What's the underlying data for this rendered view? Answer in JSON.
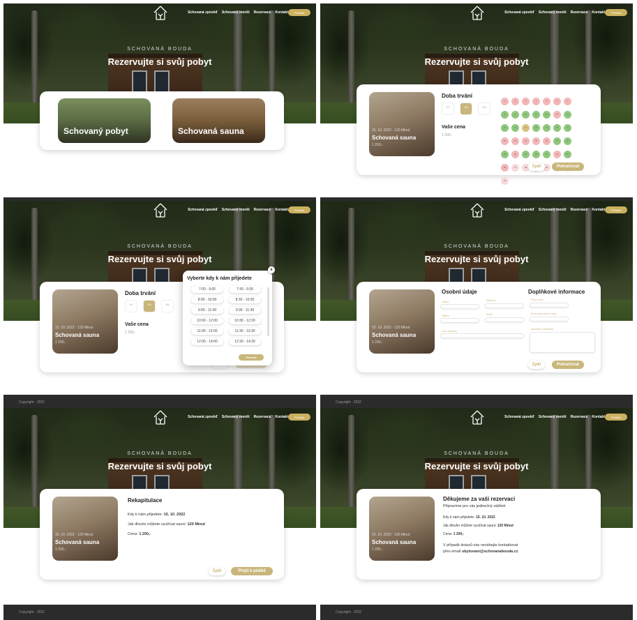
{
  "header": {
    "nav": [
      "Schovaná zpověď",
      "Schovaný menšt",
      "Rezervace",
      "Kontakt"
    ],
    "cta_label": "Přihlásit",
    "eyebrow": "SCHOVANÁ BOUDA",
    "title": "Rezervujte si svůj pobyt"
  },
  "footer": {
    "copyright": "Copyright · 2022"
  },
  "step1": {
    "options": [
      "Schovaný pobyt",
      "Schovaná sauna"
    ]
  },
  "product": {
    "date": "15. 10. 2022 · 120 Minut",
    "name": "Schovaná sauna",
    "price": "1 200,-"
  },
  "step2": {
    "duration_title": "Doba trvání",
    "durations": [
      "60",
      "120",
      "180"
    ],
    "price_title": "Vaše cena",
    "price": "1 200,-",
    "calendar": [
      "rd",
      "rd",
      "rd",
      "rd",
      "rd",
      "rd",
      "rd",
      "gr",
      "gr",
      "gr",
      "gr",
      "gr",
      "rd",
      "gr",
      "gr",
      "gr",
      "yl",
      "gr",
      "gr",
      "gr",
      "gr",
      "rd",
      "rd",
      "rd",
      "rd",
      "rd",
      "gr",
      "gr",
      "gr",
      "rd",
      "gr",
      "gr",
      "gr",
      "rd",
      "gr",
      "rd",
      "lr",
      "lr",
      "lr",
      "lr",
      "lr",
      "lr",
      "lr"
    ],
    "back_label": "Zpět",
    "next_label": "Pokračovat"
  },
  "step3": {
    "modal_title": "Vyberte kdy k nám přijedete",
    "close_label": "x",
    "slots": [
      "7:00 - 9:00",
      "7:30 - 9:30",
      "8:00 - 10:00",
      "8:30 - 10:30",
      "9:00 - 11:00",
      "9:30 - 11:30",
      "10:00 - 12:00",
      "10:30 - 12:30",
      "11:00 - 13:00",
      "11:30 - 13:30",
      "12:00 - 14:00",
      "12:30 - 14:30"
    ],
    "confirm_label": "Potvrdit"
  },
  "step4": {
    "personal_title": "Osobní údaje",
    "extra_title": "Doplňkové informace",
    "personal_fields": [
      "Jméno",
      "Příjmení",
      "Telefon",
      "Email",
      "Číslo občanky"
    ],
    "extra_fields": [
      "Počet osob",
      "Druh ubytovacích vstup",
      "Speciální požadavky"
    ]
  },
  "step5": {
    "title": "Rekapitulace",
    "arrival_label": "Kdy k nám přijedete:",
    "arrival_value": "15. 10. 2022",
    "duration_label": "Jak dlouho můžete využívat sauni:",
    "duration_value": "120 Minut",
    "price_label": "Cena:",
    "price_value": "1 200,-",
    "back_label": "Zpět",
    "pay_label": "Přejít k platbě"
  },
  "step6": {
    "title": "Děkujeme za vaši rezervaci",
    "subtitle": "Připravíme pro vás jedinečný zážitek",
    "arrival_label": "Kdy k nám přijedete:",
    "arrival_value": "15. 10. 2022",
    "duration_label": "Jak dlouho můžete využívat sauni:",
    "duration_value": "120 Minut",
    "price_label": "Cena:",
    "price_value": "1 200,-",
    "contact_line1": "V případě dotazů nás neváhejte kontaktovat",
    "contact_line2_prefix": "přes email",
    "contact_email": "ubytovani@schovanabouda.cz"
  },
  "colors": {
    "accent": "#c9b67a",
    "footer": "#2b2b2b",
    "available": "#8fc77d",
    "booked": "#f3b6b6"
  }
}
